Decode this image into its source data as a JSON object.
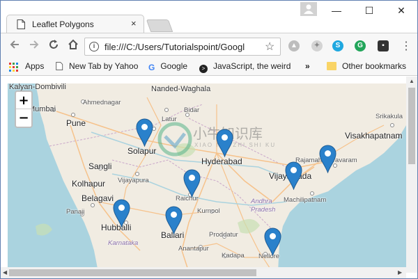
{
  "browser": {
    "tab_title": "Leaflet Polygons",
    "tab_close": "×",
    "window_controls": {
      "minimize": "—",
      "maximize": "☐",
      "close": "✕"
    },
    "url": "file:///C:/Users/Tutorialspoint/Googl",
    "nav_icons": [
      "back-arrow-icon",
      "forward-arrow-icon",
      "reload-icon",
      "home-icon"
    ]
  },
  "bookmarks": {
    "apps": "Apps",
    "items": [
      "New Tab by Yahoo",
      "Google",
      "JavaScript, the weird"
    ],
    "overflow": "»",
    "other": "Other bookmarks"
  },
  "map": {
    "zoom_in": "+",
    "zoom_out": "−",
    "places": {
      "kalyan": "Kalyan-Dombivili",
      "nanded": "Nanded-Waghala",
      "mumbai": "Mumbai",
      "ahmednagar": "Ahmednagar",
      "bidar": "Bidar",
      "latur": "Latur",
      "srikakulam": "Srikakula",
      "pune": "Pune",
      "visakhapatnam": "Visakhapatnam",
      "solapur": "Solapur",
      "hyderabad": "Hyderabad",
      "rajamahendravaram": "Rajamahendravaram",
      "sangli": "Sangli",
      "vijayawada": "Vijayawada",
      "kolhapur": "Kolhapur",
      "vijayapura": "Vijayapura",
      "belagavi": "Belagavi",
      "raichur": "Raichur",
      "machilipatnam": "Machilipatnam",
      "panaji": "Panaji",
      "kurnool": "Kurnool",
      "andhra": "Andhra",
      "pradesh": "Pradesh",
      "hubballi": "Hubballi",
      "karnataka": "Karnataka",
      "ballari": "Ballari",
      "proddatur": "Proddatur",
      "anantapur": "Anantapur",
      "kadapa": "Kadapa",
      "nellore": "Nellore"
    },
    "watermark": {
      "text": "小牛知识库",
      "sub": "XIAO NIU ZHI SHI KU"
    }
  },
  "colors": {
    "land": "#f1ece2",
    "sea": "#aad3df",
    "marker": "#2a81cb",
    "marker_dark": "#1e5c94",
    "road": "#f6c28b"
  }
}
